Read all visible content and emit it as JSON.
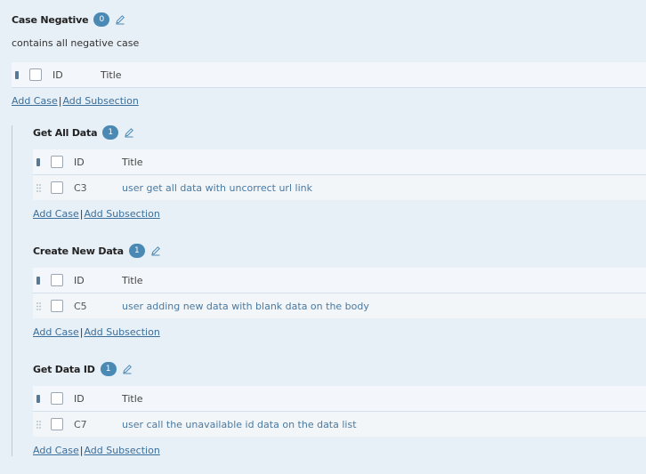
{
  "section": {
    "title": "Case Negative",
    "count": "0",
    "description": "contains all negative case",
    "header": {
      "id": "ID",
      "title": "Title"
    },
    "add_case": "Add Case",
    "add_subsection": "Add Subsection",
    "separator": "|"
  },
  "subsections": [
    {
      "title": "Get All Data",
      "count": "1",
      "header": {
        "id": "ID",
        "title": "Title"
      },
      "rows": [
        {
          "id": "C3",
          "title": "user get all data with uncorrect url link"
        }
      ],
      "add_case": "Add Case",
      "add_subsection": "Add Subsection",
      "separator": "|"
    },
    {
      "title": "Create New Data",
      "count": "1",
      "header": {
        "id": "ID",
        "title": "Title"
      },
      "rows": [
        {
          "id": "C5",
          "title": "user adding new data with blank data on the body"
        }
      ],
      "add_case": "Add Case",
      "add_subsection": "Add Subsection",
      "separator": "|"
    },
    {
      "title": "Get Data ID",
      "count": "1",
      "header": {
        "id": "ID",
        "title": "Title"
      },
      "rows": [
        {
          "id": "C7",
          "title": "user call the unavailable id data on the data list"
        }
      ],
      "add_case": "Add Case",
      "add_subsection": "Add Subsection",
      "separator": "|"
    }
  ],
  "icons": {
    "edit": "pencil-icon",
    "drag": "drag-handle-icon",
    "column_handle": "column-handle-icon"
  },
  "colors": {
    "background": "#e7eff7",
    "badge": "#4b89b5",
    "link": "#3b6f9b",
    "row_title": "#4a79a0"
  }
}
